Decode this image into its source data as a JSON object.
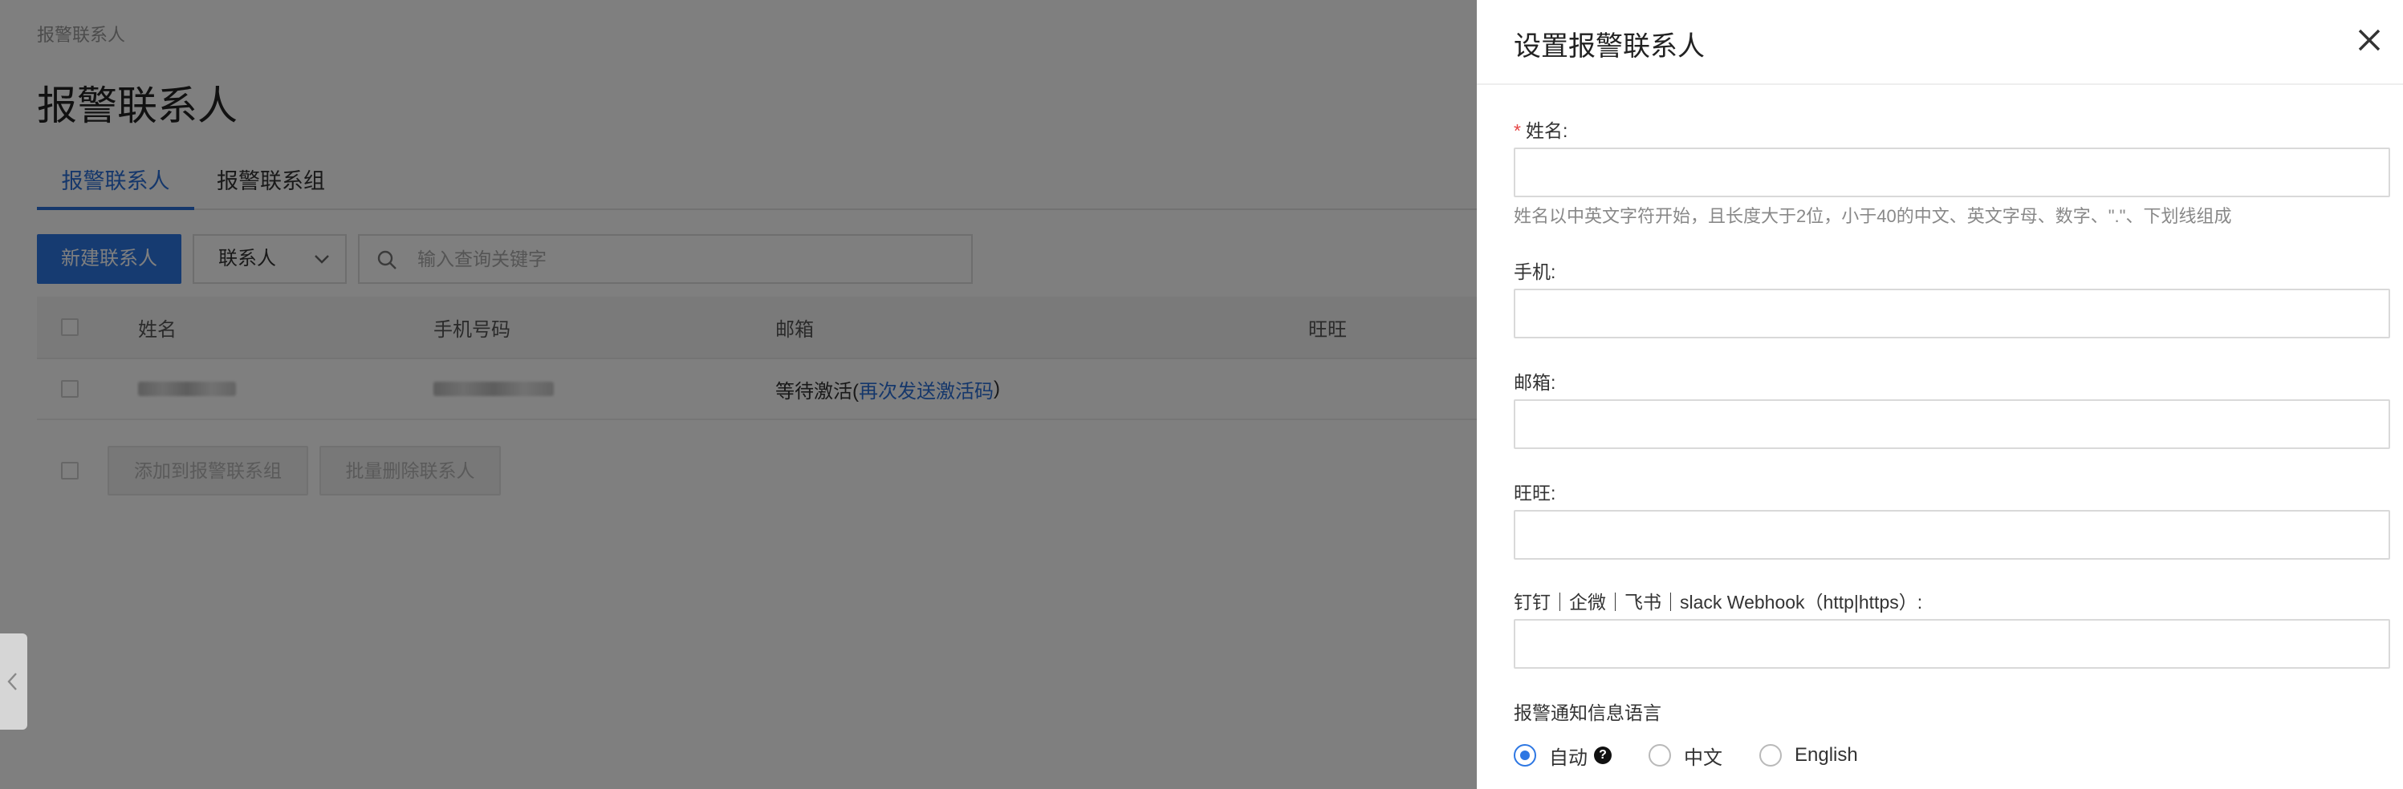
{
  "breadcrumb": "报警联系人",
  "page_title": "报警联系人",
  "tabs": [
    {
      "label": "报警联系人",
      "active": true
    },
    {
      "label": "报警联系组",
      "active": false
    }
  ],
  "toolbar": {
    "new_contact_label": "新建联系人",
    "filter_select_value": "联系人",
    "search_placeholder": "输入查询关键字"
  },
  "table": {
    "columns": [
      "姓名",
      "手机号码",
      "邮箱",
      "旺旺"
    ],
    "rows": [
      {
        "name": "[redacted]",
        "phone": "[redacted]",
        "email_status": "等待激活(",
        "email_link": "再次发送激活码",
        "email_suffix": ")",
        "wangwang": ""
      }
    ]
  },
  "bulk_actions": {
    "add_to_group_label": "添加到报警联系组",
    "batch_delete_label": "批量删除联系人"
  },
  "drawer": {
    "title": "设置报警联系人",
    "name": {
      "required_mark": "*",
      "label": "姓名:",
      "value": "",
      "help": "姓名以中英文字符开始，且长度大于2位，小于40的中文、英文字母、数字、\".\"、下划线组成"
    },
    "phone": {
      "label": "手机:",
      "value": ""
    },
    "email": {
      "label": "邮箱:",
      "value": ""
    },
    "wangwang": {
      "label": "旺旺:",
      "value": ""
    },
    "webhook": {
      "label": "钉钉｜企微｜飞书｜slack Webhook（http|https）:",
      "value": ""
    },
    "language": {
      "label": "报警通知信息语言",
      "options": [
        {
          "label": "自动",
          "selected": true,
          "help_icon": "?"
        },
        {
          "label": "中文",
          "selected": false
        },
        {
          "label": "English",
          "selected": false
        }
      ]
    }
  },
  "colors": {
    "accent": "#2d77e3",
    "link": "#2b6fd6",
    "required": "#e54545",
    "overlay": "rgba(0,0,0,0.5)"
  },
  "icons": {
    "close": "close-icon",
    "search": "search-icon",
    "chevron": "chevron-down-icon",
    "help": "question-circle-icon",
    "collapse": "chevron-left-icon"
  }
}
